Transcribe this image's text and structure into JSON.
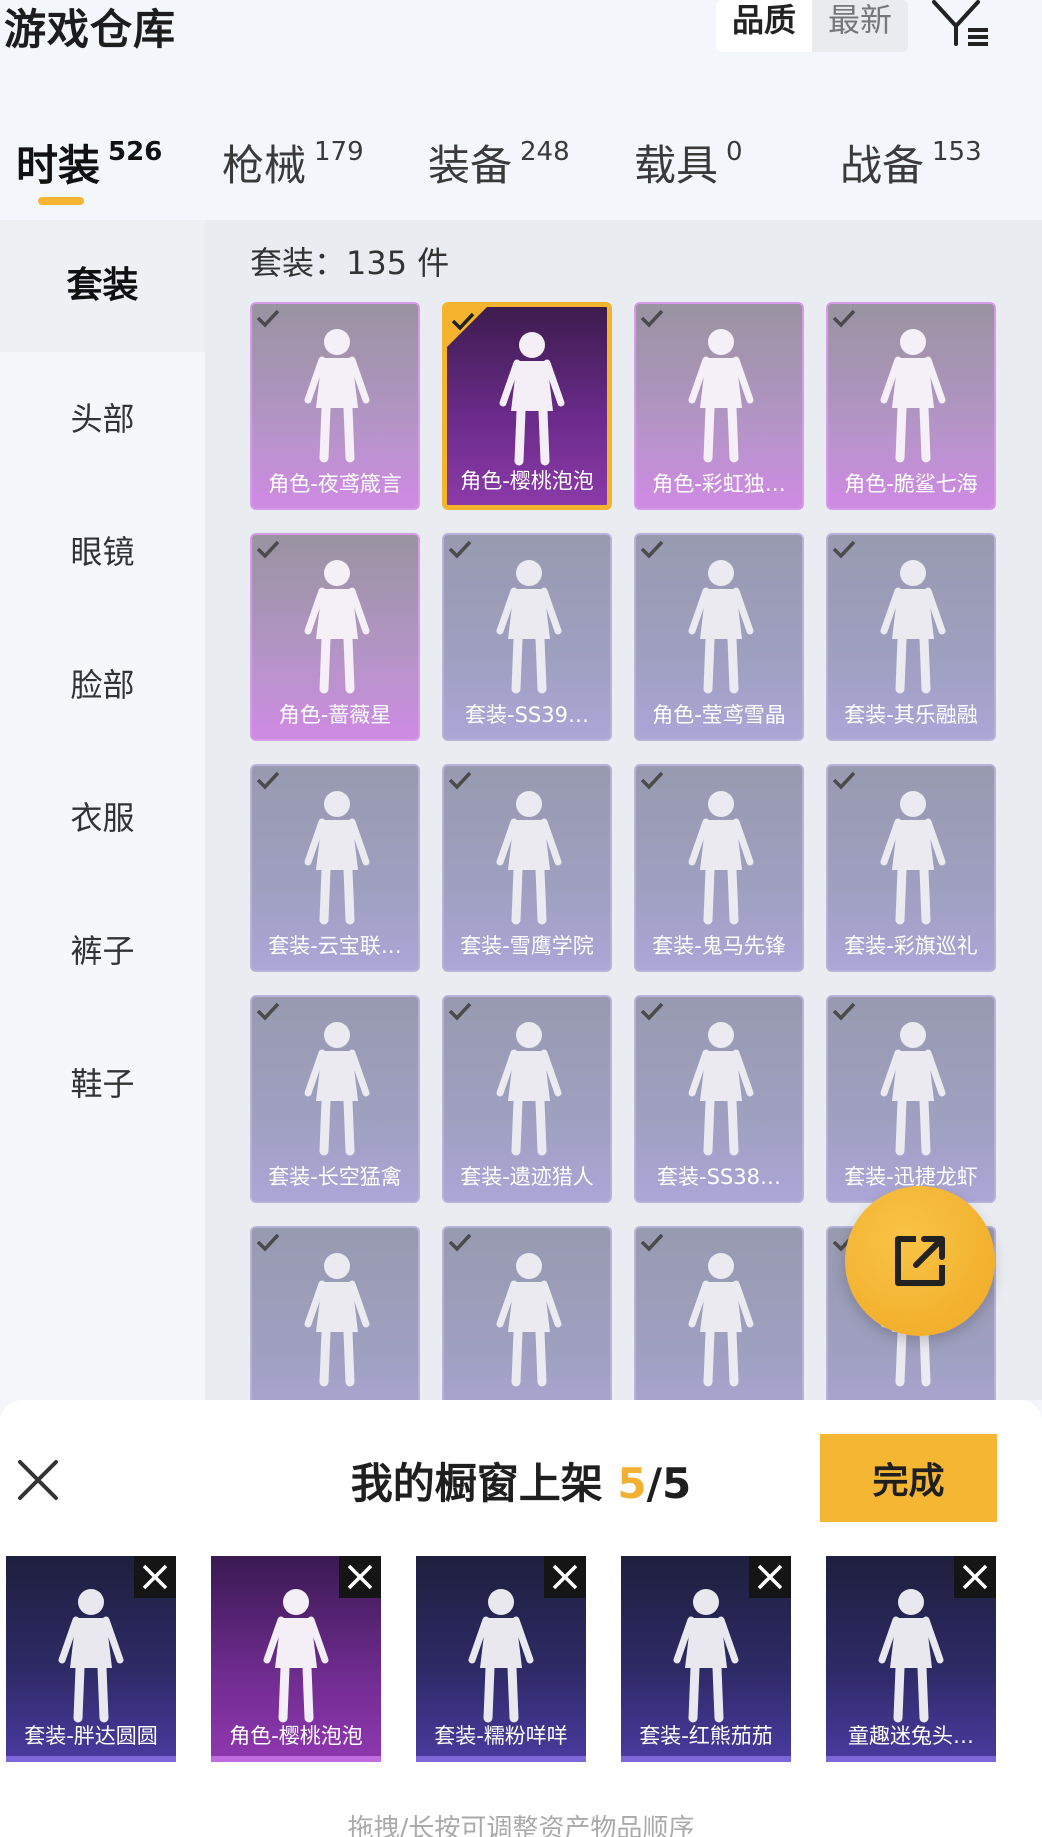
{
  "header": {
    "title": "游戏仓库",
    "sort_options": [
      "品质",
      "最新"
    ],
    "sort_active": "品质",
    "filter_icon": "filter-icon"
  },
  "tabs": [
    {
      "label": "时装",
      "count": "526",
      "active": true
    },
    {
      "label": "枪械",
      "count": "179"
    },
    {
      "label": "装备",
      "count": "248"
    },
    {
      "label": "载具",
      "count": "0"
    },
    {
      "label": "战备",
      "count": "153"
    }
  ],
  "sidebar": {
    "items": [
      {
        "label": "套装",
        "active": true
      },
      {
        "label": "头部"
      },
      {
        "label": "眼镜"
      },
      {
        "label": "脸部"
      },
      {
        "label": "衣服"
      },
      {
        "label": "裤子"
      },
      {
        "label": "鞋子"
      }
    ]
  },
  "grid": {
    "count_label": "套装：135 件",
    "items": [
      {
        "name": "角色-夜鸢箴言",
        "kind": "char"
      },
      {
        "name": "角色-樱桃泡泡",
        "kind": "char",
        "selected": true
      },
      {
        "name": "角色-彩虹独…",
        "kind": "char"
      },
      {
        "name": "角色-脆鲨七海",
        "kind": "char"
      },
      {
        "name": "角色-蔷薇星",
        "kind": "char"
      },
      {
        "name": "套装-SS39…",
        "kind": "set"
      },
      {
        "name": "角色-莹鸢雪晶",
        "kind": "set"
      },
      {
        "name": "套装-其乐融融",
        "kind": "set"
      },
      {
        "name": "套装-云宝联…",
        "kind": "set"
      },
      {
        "name": "套装-雪鹰学院",
        "kind": "set"
      },
      {
        "name": "套装-鬼马先锋",
        "kind": "set"
      },
      {
        "name": "套装-彩旗巡礼",
        "kind": "set"
      },
      {
        "name": "套装-长空猛禽",
        "kind": "set"
      },
      {
        "name": "套装-遗迹猎人",
        "kind": "set"
      },
      {
        "name": "套装-SS38…",
        "kind": "set"
      },
      {
        "name": "套装-迅捷龙虾",
        "kind": "set"
      },
      {
        "name": "",
        "kind": "set"
      },
      {
        "name": "",
        "kind": "set"
      },
      {
        "name": "",
        "kind": "set"
      },
      {
        "name": "",
        "kind": "set"
      }
    ]
  },
  "panel": {
    "title_prefix": "我的橱窗上架 ",
    "current": "5",
    "separator": "/",
    "max": "5",
    "done_label": "完成",
    "items": [
      {
        "name": "套装-胖达圆圆",
        "kind": "set"
      },
      {
        "name": "角色-樱桃泡泡",
        "kind": "char"
      },
      {
        "name": "套装-糯粉咩咩",
        "kind": "set"
      },
      {
        "name": "套装-红熊茄茄",
        "kind": "set"
      },
      {
        "name": "童趣迷兔头…",
        "kind": "set"
      }
    ],
    "hint": "拖拽/长按可调整资产物品顺序"
  },
  "colors": {
    "accent": "#f5b733",
    "selected_border": "#f5b42e",
    "char_card": "#c97be0",
    "set_card": "#a19ad2"
  }
}
